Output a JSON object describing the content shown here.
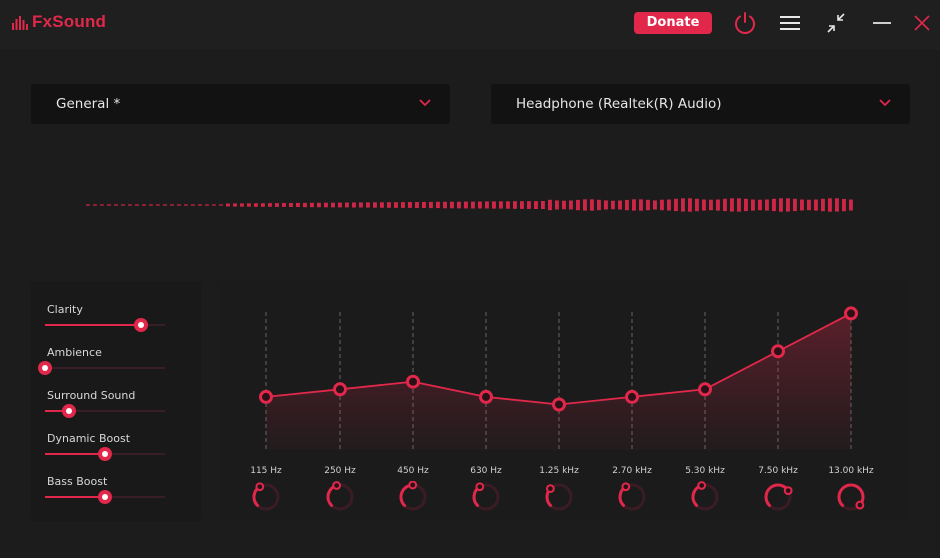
{
  "app": {
    "name": "FxSound",
    "donate_label": "Donate",
    "accent_color": "#e1284b"
  },
  "titlebar": {
    "icons": [
      "power-icon",
      "menu-icon",
      "minimize-view-icon",
      "minimize-icon",
      "close-icon"
    ]
  },
  "preset": {
    "selected": "General *"
  },
  "output_device": {
    "selected": "Headphone (Realtek(R) Audio)"
  },
  "effects": [
    {
      "label": "Clarity",
      "value": 0.8
    },
    {
      "label": "Ambience",
      "value": 0.0
    },
    {
      "label": "Surround Sound",
      "value": 0.2
    },
    {
      "label": "Dynamic Boost",
      "value": 0.5
    },
    {
      "label": "Bass Boost",
      "value": 0.5
    }
  ],
  "equalizer": {
    "bands": [
      {
        "label": "115 Hz",
        "level": 0.385
      },
      {
        "label": "250 Hz",
        "level": 0.44
      },
      {
        "label": "450 Hz",
        "level": 0.495
      },
      {
        "label": "630 Hz",
        "level": 0.385
      },
      {
        "label": "1.25 kHz",
        "level": 0.33
      },
      {
        "label": "2.70 kHz",
        "level": 0.385
      },
      {
        "label": "5.30 kHz",
        "level": 0.44
      },
      {
        "label": "7.50 kHz",
        "level": 0.715
      },
      {
        "label": "13.00 kHz",
        "level": 0.99
      }
    ]
  }
}
